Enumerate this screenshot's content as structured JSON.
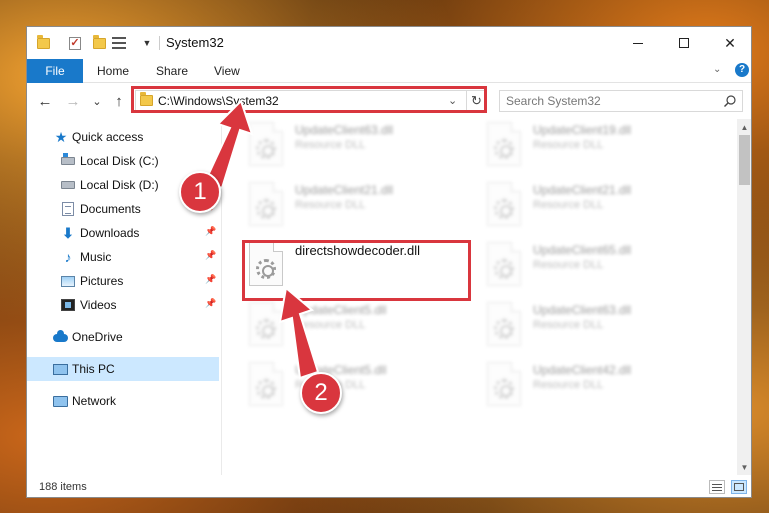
{
  "window": {
    "title": "System32",
    "controls": {
      "minimize": "minimize",
      "maximize": "maximize",
      "close": "✕"
    }
  },
  "ribbon": {
    "tabs": [
      "File",
      "Home",
      "Share",
      "View"
    ],
    "help": "?",
    "accent": "#1979ca"
  },
  "nav": {
    "back": "←",
    "forward": "→",
    "recent": "⌄",
    "up": "↑",
    "address": "C:\\Windows\\System32",
    "search_placeholder": "Search System32"
  },
  "sidebar": {
    "items": [
      {
        "label": "Quick access",
        "icon": "star-icon",
        "pinned": false
      },
      {
        "label": "Local Disk (C:)",
        "icon": "drive-icon",
        "pinned": false
      },
      {
        "label": "Local Disk (D:)",
        "icon": "drive-icon",
        "pinned": false
      },
      {
        "label": "Documents",
        "icon": "documents-icon",
        "pinned": true
      },
      {
        "label": "Downloads",
        "icon": "downloads-icon",
        "pinned": true
      },
      {
        "label": "Music",
        "icon": "music-icon",
        "pinned": true
      },
      {
        "label": "Pictures",
        "icon": "pictures-icon",
        "pinned": true
      },
      {
        "label": "Videos",
        "icon": "videos-icon",
        "pinned": true
      },
      {
        "label": "OneDrive",
        "icon": "cloud-icon",
        "pinned": false
      },
      {
        "label": "This PC",
        "icon": "computer-icon",
        "pinned": false,
        "selected": true
      },
      {
        "label": "Network",
        "icon": "network-icon",
        "pinned": false
      }
    ]
  },
  "files": [
    {
      "name": "UpdateClient63.dll",
      "type": "Resource DLL",
      "blurred": true
    },
    {
      "name": "UpdateClient19.dll",
      "type": "Resource DLL",
      "blurred": true
    },
    {
      "name": "UpdateClient21.dll",
      "type": "Resource DLL",
      "blurred": true
    },
    {
      "name": "UpdateClient21.dll",
      "type": "Resource DLL",
      "blurred": true
    },
    {
      "name": "directshowdecoder.dll",
      "type": "",
      "blurred": false
    },
    {
      "name": "UpdateClient65.dll",
      "type": "Resource DLL",
      "blurred": true
    },
    {
      "name": "UpdateClient5.dll",
      "type": "Resource DLL",
      "blurred": true
    },
    {
      "name": "UpdateClient63.dll",
      "type": "Resource DLL",
      "blurred": true
    },
    {
      "name": "UpdateClient5.dll",
      "type": "Resource DLL",
      "blurred": true
    },
    {
      "name": "UpdateClient42.dll",
      "type": "Resource DLL",
      "blurred": true
    }
  ],
  "status": {
    "item_count": "188 items"
  },
  "annotations": {
    "step1": "1",
    "step2": "2",
    "color": "#d9363e"
  }
}
